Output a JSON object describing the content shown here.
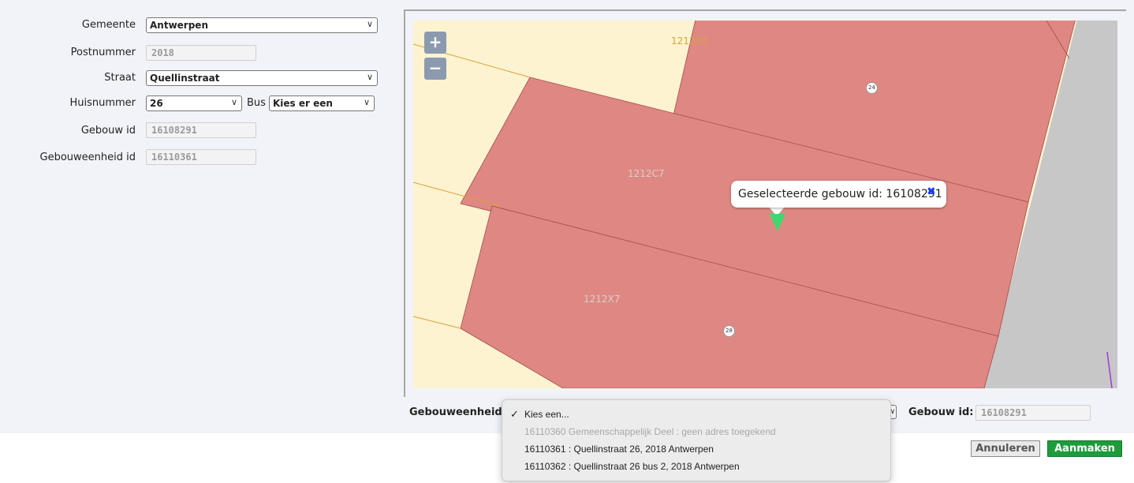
{
  "form": {
    "gemeente": {
      "label": "Gemeente",
      "value": "Antwerpen"
    },
    "postnummer": {
      "label": "Postnummer",
      "value": "2018"
    },
    "straat": {
      "label": "Straat",
      "value": "Quellinstraat"
    },
    "huisnummer": {
      "label": "Huisnummer",
      "value": "26"
    },
    "bus": {
      "label": "Bus",
      "value": "Kies er een"
    },
    "gebouw_id": {
      "label": "Gebouw id",
      "value": "16108291"
    },
    "gebouweenheid_id": {
      "label": "Gebouweenheid id",
      "value": "16110361"
    }
  },
  "map": {
    "zoom_in": "+",
    "zoom_out": "−",
    "parcels": [
      "1212X2",
      "1212C7",
      "1212X7"
    ],
    "house_numbers": [
      "24",
      "28"
    ],
    "popup_text": "Geselecteerde gebouw id: 16108291",
    "popup_close": "✖",
    "colors": {
      "parcel_bg": "#fdf3d0",
      "building": "#df8883",
      "road": "#c7c7c7",
      "marker": "#3ed870"
    }
  },
  "bottom": {
    "gebouweenheid_label": "Gebouweenheid",
    "gebouw_id_label": "Gebouw id:",
    "gebouw_id_value": "16108291"
  },
  "dropdown": {
    "options": [
      {
        "label": "Kies een...",
        "checked": true,
        "disabled": false
      },
      {
        "label": "16110360 Gemeenschappelijk Deel : geen adres toegekend",
        "checked": false,
        "disabled": true
      },
      {
        "label": "16110361 : Quellinstraat 26, 2018 Antwerpen",
        "checked": false,
        "disabled": false
      },
      {
        "label": "16110362 : Quellinstraat 26 bus 2, 2018 Antwerpen",
        "checked": false,
        "disabled": false
      }
    ]
  },
  "buttons": {
    "cancel": "Annuleren",
    "create": "Aanmaken"
  }
}
